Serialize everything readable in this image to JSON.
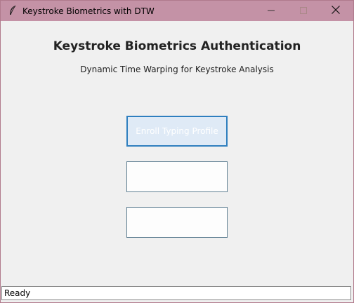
{
  "window": {
    "title": "Keystroke Biometrics with DTW",
    "app_icon": "feather-icon",
    "controls": {
      "minimize_icon": "minimize-icon",
      "maximize_icon": "maximize-icon",
      "close_icon": "close-icon"
    }
  },
  "main": {
    "heading": "Keystroke Biometrics Authentication",
    "subheading": "Dynamic Time Warping for Keystroke Analysis",
    "buttons": [
      {
        "label": "Enroll Typing Profile",
        "state": "focused"
      },
      {
        "label": "",
        "state": "normal"
      },
      {
        "label": "",
        "state": "normal"
      }
    ]
  },
  "status": {
    "text": "Ready"
  },
  "colors": {
    "titlebar": "#c492a6",
    "background": "#f0f0f0",
    "focus_border": "#2f7fbf",
    "focus_fill": "#dfeaf6"
  }
}
